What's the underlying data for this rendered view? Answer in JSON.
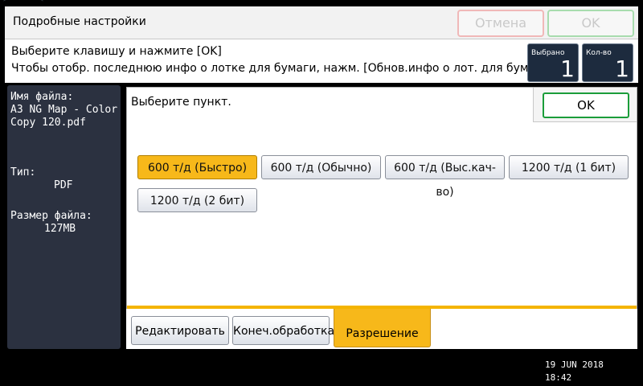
{
  "header": {
    "title": "Подробные настройки",
    "cancel_label": "Отмена",
    "ok_label": "OK"
  },
  "message": {
    "line1": "Выберите клавишу и нажмите [OK]",
    "line2": "Чтобы отобр. последнюю инфо о лотке для бумаги, нажм. [Обнов.инфо о лот. для бум.]."
  },
  "counters": {
    "selected_label": "Выбрано",
    "selected_value": "1",
    "quantity_label": "Кол-во",
    "quantity_value": "1"
  },
  "file_info": {
    "name_label": "Имя файла:",
    "name_value": "A3 NG Map - Color Copy 120.pdf",
    "type_label": "Тип:",
    "type_value": "PDF",
    "size_label": "Размер файла:",
    "size_value": "127MB"
  },
  "main": {
    "prompt": "Выберите пункт.",
    "ok_label": "OK",
    "options": [
      {
        "label": "600 т/д (Быстро)",
        "selected": true
      },
      {
        "label": "600 т/д (Обычно)",
        "selected": false
      },
      {
        "label": "600 т/д (Выс.кач-во)",
        "selected": false
      },
      {
        "label": "1200 т/д (1 бит)",
        "selected": false
      },
      {
        "label": "1200 т/д (2 бит)",
        "selected": false
      }
    ]
  },
  "tabs": [
    {
      "label": "Редактировать",
      "active": false
    },
    {
      "label": "Конеч.обработка",
      "active": false
    },
    {
      "label": "Разрешение",
      "active": true
    }
  ],
  "status": {
    "date": "19 JUN  2018",
    "time": "18:42"
  },
  "colors": {
    "accent_selected": "#f7b81a",
    "ok_border": "#1b9d3a",
    "panel_dark": "#2b3140"
  }
}
